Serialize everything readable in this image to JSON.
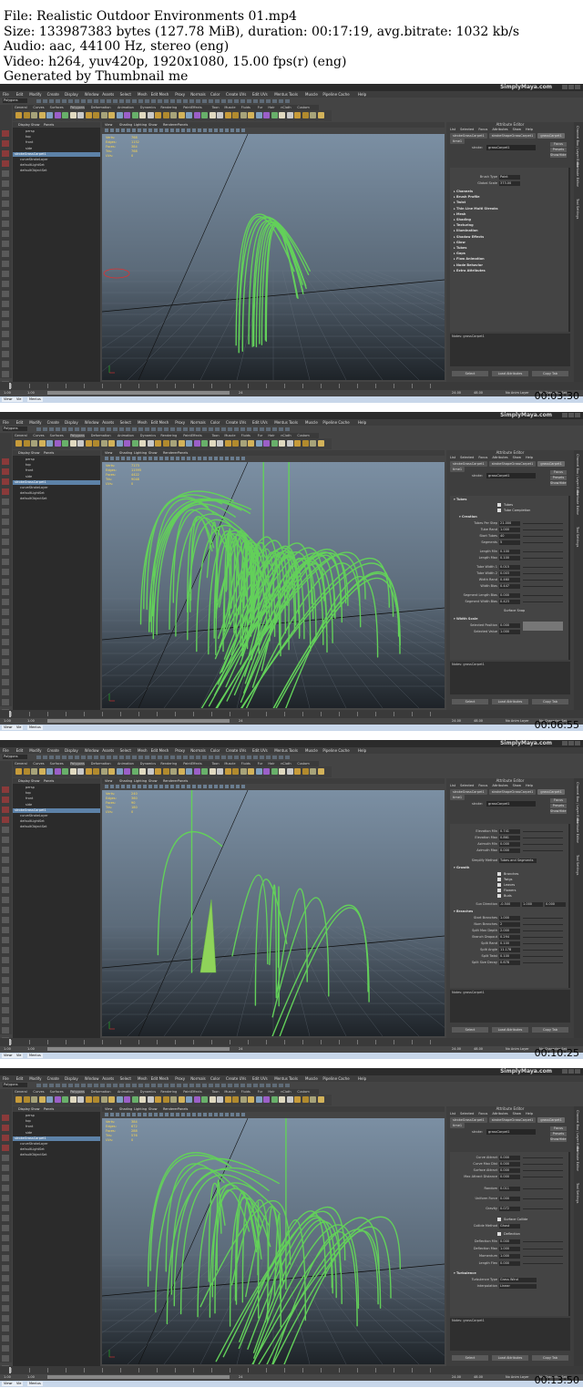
{
  "info": {
    "line1": "File: Realistic Outdoor Environments 01.mp4",
    "line2": "Size: 133987383 bytes (127.78 MiB), duration: 00:17:19, avg.bitrate: 1032 kb/s",
    "line3": "Audio: aac, 44100 Hz, stereo (eng)",
    "line4": "Video: h264, yuv420p, 1920x1080, 15.00 fps(r) (eng)",
    "line5": "Generated by Thumbnail me"
  },
  "app": {
    "brand": "SimplyMaya.com",
    "menu": [
      "File",
      "Edit",
      "Modify",
      "Create",
      "Display",
      "Window",
      "Assets",
      "Select",
      "Mesh",
      "Edit Mesh",
      "Proxy",
      "Normals",
      "Color",
      "Create UVs",
      "Edit UVs",
      "Mentus Tools",
      "Muscle",
      "Pipeline Cache",
      "Help"
    ],
    "mode": "Polygons",
    "shelf_tabs": [
      "General",
      "Curves",
      "Surfaces",
      "Polygons",
      "Deformation",
      "Animation",
      "Dynamics",
      "Rendering",
      "PaintEffects",
      "Toon",
      "Muscle",
      "Fluids",
      "Fur",
      "Hair",
      "nCloth",
      "Custom"
    ],
    "outliner_menu": [
      "Display",
      "Show",
      "Panels"
    ],
    "outliner_items": [
      "persp",
      "top",
      "front",
      "side",
      "strokeGrassCarpet1",
      "curveStrokeLayer",
      "defaultLightSet",
      "defaultObjectSet"
    ],
    "viewport_menu": [
      "View",
      "Shading",
      "Lighting",
      "Show",
      "Renderer",
      "Panels"
    ],
    "hud_labels": [
      "Verts:",
      "Edges:",
      "Faces:",
      "Tris:",
      "UVs:"
    ],
    "ae_title": "Attribute Editor",
    "ae_menu": [
      "List",
      "Selected",
      "Focus",
      "Attributes",
      "Show",
      "Help"
    ],
    "ae_tabs": [
      "strokeGrassCarpet1",
      "strokeShapeGrassCarpet1",
      "grassCarpet1",
      "time1"
    ],
    "stroke_label": "stroke:",
    "stroke_value": "grassCarpet1",
    "side_buttons": [
      "Focus",
      "Presets",
      "Show",
      "Hide"
    ],
    "notes": "Notes: grassCarpet1",
    "bottom_buttons": [
      "Select",
      "Load Attributes",
      "Copy Tab"
    ],
    "channel_tabs": [
      "Channel Box / Layer Editor",
      "Attribute Editor",
      "Tool Settings"
    ],
    "range": {
      "start": "1.00",
      "start2": "1.00",
      "current": "1",
      "end": "24",
      "end2": "24.00",
      "end3": "48.00",
      "anim_layer": "No Anim Layer",
      "char_set": "No Character Set"
    },
    "mel": "MEL",
    "task_items": [
      "Viewr",
      "Vie",
      "Mentus"
    ]
  },
  "frames": [
    {
      "timestamp": "00:03:30",
      "hud": [
        "768",
        "1152",
        "384",
        "768",
        "0"
      ],
      "ae": {
        "type": "list",
        "brush_type_label": "Brush Type",
        "brush_type": "Paint",
        "global_scale_label": "Global Scale",
        "global_scale": "373.00",
        "sections": [
          "Channels",
          "Brush Profile",
          "Twist",
          "Thin Line Multi Streaks",
          "Mesh",
          "Shading",
          "Texturing",
          "Illumination",
          "Shadow Effects",
          "Glow",
          "Tubes",
          "Gaps",
          "Flow Animation",
          "Node Behavior",
          "Extra Attributes"
        ]
      }
    },
    {
      "timestamp": "00:06:55",
      "hud": [
        "7173",
        "11595",
        "4422",
        "9048",
        "0"
      ],
      "ae": {
        "type": "tubes",
        "header": "Tubes",
        "checks": [
          "Tubes",
          "Tube Completion"
        ],
        "sub": "Creation",
        "rows": [
          [
            "Tubes Per Step",
            "21.000"
          ],
          [
            "Tube Rand",
            "1.000"
          ],
          [
            "Start Tubes",
            "40"
          ],
          [
            "Segments",
            "5"
          ],
          [
            "Length Min",
            "0.100"
          ],
          [
            "Length Max",
            "0.100"
          ],
          [
            "Tube Width 1",
            "0.015"
          ],
          [
            "Tube Width 2",
            "0.003"
          ],
          [
            "Width Rand",
            "0.460"
          ],
          [
            "Width Bias",
            "0.447"
          ],
          [
            "Segment Length Bias",
            "0.000"
          ],
          [
            "Segment Width Bias",
            "0.423"
          ]
        ],
        "note": "Surface Snap",
        "sub2": "Width Scale",
        "sel_pos": "Selected Position",
        "sel_pos_val": "0.000",
        "sel_val": "Selected Value",
        "sel_val_val": "1.000"
      }
    },
    {
      "timestamp": "00:10:25",
      "hud": [
        "240",
        "360",
        "90",
        "180",
        "0"
      ],
      "ae": {
        "type": "growth",
        "rows_top": [
          [
            "Elevation Min",
            "0.741"
          ],
          [
            "Elevation Max",
            "0.861"
          ],
          [
            "Azimuth Min",
            "0.000"
          ],
          [
            "Azimuth Max",
            "0.000"
          ]
        ],
        "simplify_label": "Simplify Method",
        "simplify": "Tubes and Segments",
        "growth": "Growth",
        "checks": [
          "Branches",
          "Twigs",
          "Leaves",
          "Flowers",
          "Buds"
        ],
        "sun_label": "Sun Direction",
        "sun": [
          "-0.500",
          "1.000",
          "0.000"
        ],
        "branches": "Branches",
        "rows": [
          [
            "Start Branches",
            "1.000"
          ],
          [
            "Num Branches",
            "2"
          ],
          [
            "Split Max Depth",
            "2.000"
          ],
          [
            "Branch Dropout",
            "0.294"
          ],
          [
            "Split Rand",
            "0.100"
          ],
          [
            "Split Angle",
            "11.178"
          ],
          [
            "Split Twist",
            "0.100"
          ],
          [
            "Split Size Decay",
            "0.678"
          ]
        ]
      }
    },
    {
      "timestamp": "00:13:50",
      "hud": [
        "384",
        "672",
        "288",
        "576",
        "0"
      ],
      "ae": {
        "type": "forces",
        "rows_top": [
          [
            "Curve Attract",
            "0.000"
          ],
          [
            "Curve Max Dist",
            "0.000"
          ],
          [
            "Surface Attract",
            "0.000"
          ],
          [
            "Max Attract Distance",
            "0.000"
          ]
        ],
        "rows": [
          [
            "Random",
            "0.011"
          ],
          [
            "Uniform Force",
            "0.000"
          ],
          [
            "Gravity",
            "0.072"
          ]
        ],
        "coll": "Surface Collide",
        "coll_method_label": "Collide Method",
        "coll_method": "Ghost",
        "defl": "Deflection",
        "rows2": [
          [
            "Deflection Min",
            "0.000"
          ],
          [
            "Deflection Max",
            "1.000"
          ],
          [
            "Momentum",
            "1.000"
          ],
          [
            "Length Flex",
            "0.000"
          ]
        ],
        "turb": "Turbulence",
        "turb_type_label": "Turbulence Type",
        "turb_type": "Grass Wind",
        "interp_label": "Interpolation",
        "interp": "Linear"
      }
    }
  ]
}
